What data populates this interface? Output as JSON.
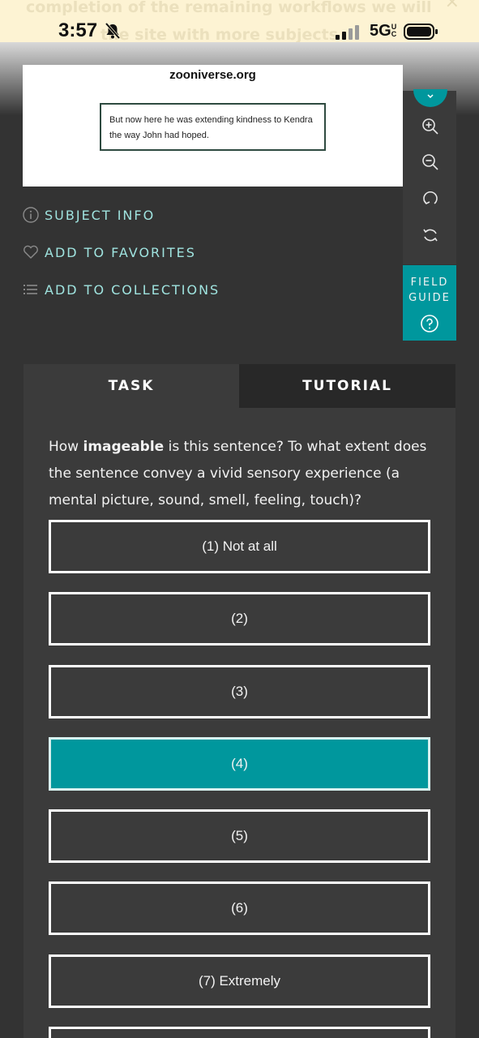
{
  "banner": {
    "line1": "completion of the remaining workflows we will",
    "line2": "the site with more subjects",
    "close": "×"
  },
  "status_bar": {
    "time": "3:57",
    "network": "5G",
    "network_suffix": "UC",
    "icons": [
      "bell-slash-icon",
      "signal-icon",
      "battery-icon"
    ]
  },
  "subject": {
    "site": "zooniverse.org",
    "sentence_line1": "But now here he was extending kindness to Kendra",
    "sentence_line2": "the way John had hoped."
  },
  "toolbar": {
    "icons": [
      "zoom-in-icon",
      "zoom-out-icon",
      "rotate-icon",
      "reset-icon"
    ],
    "field_guide_line1": "FIELD",
    "field_guide_line2": "GUIDE"
  },
  "links": {
    "subject_info": "SUBJECT INFO",
    "favorites": "ADD TO FAVORITES",
    "collections": "ADD TO COLLECTIONS"
  },
  "tabs": {
    "task": "TASK",
    "tutorial": "TUTORIAL"
  },
  "question": {
    "prefix": "How ",
    "bold": "imageable",
    "suffix": " is this sentence? To what extent does the sentence convey a vivid sensory experience (a mental picture, sound, smell, feeling, touch)?"
  },
  "answers": [
    "(1) Not at all",
    "(2)",
    "(3)",
    "(4)",
    "(5)",
    "(6)",
    "(7) Extremely"
  ],
  "selected_answer": "(4)",
  "colors": {
    "accent": "#00979d",
    "link": "#9fe3df",
    "background": "#333333",
    "banner": "#fdf3d3"
  }
}
